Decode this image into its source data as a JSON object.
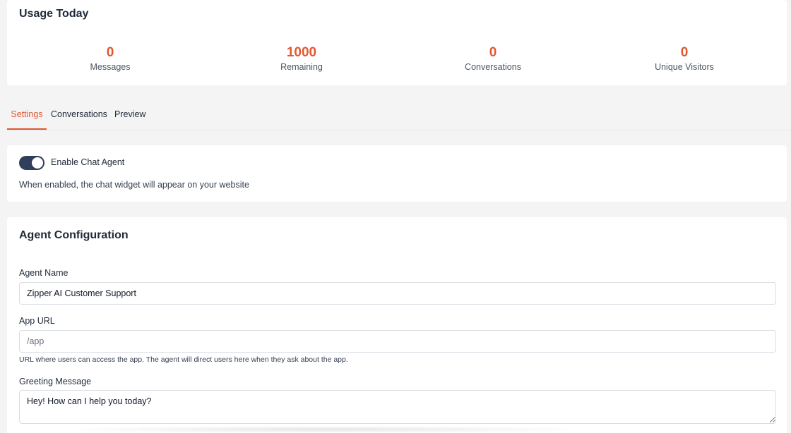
{
  "usage": {
    "title": "Usage Today",
    "stats": [
      {
        "value": "0",
        "label": "Messages"
      },
      {
        "value": "1000",
        "label": "Remaining"
      },
      {
        "value": "0",
        "label": "Conversations"
      },
      {
        "value": "0",
        "label": "Unique Visitors"
      }
    ]
  },
  "tabs": [
    {
      "label": "Settings",
      "active": true
    },
    {
      "label": "Conversations",
      "active": false
    },
    {
      "label": "Preview",
      "active": false
    }
  ],
  "enable": {
    "label": "Enable Chat Agent",
    "enabled": true,
    "help": "When enabled, the chat widget will appear on your website"
  },
  "config": {
    "title": "Agent Configuration",
    "agent_name": {
      "label": "Agent Name",
      "value": "Zipper AI Customer Support"
    },
    "app_url": {
      "label": "App URL",
      "value": "",
      "placeholder": "/app",
      "help": "URL where users can access the app. The agent will direct users here when they ask about the app."
    },
    "greeting": {
      "label": "Greeting Message",
      "value": "Hey! How can I help you today?"
    }
  },
  "colors": {
    "accent": "#e0582f",
    "toggle_on": "#2f3e5a"
  }
}
